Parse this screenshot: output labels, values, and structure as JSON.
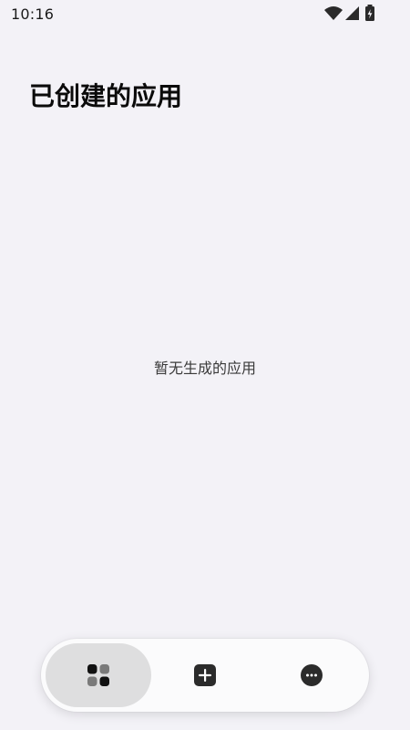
{
  "status_bar": {
    "time": "10:16",
    "icons": [
      "wifi-icon",
      "cellular-signal-icon",
      "battery-charging-icon"
    ]
  },
  "header": {
    "title": "已创建的应用"
  },
  "main": {
    "empty_state_text": "暂无生成的应用"
  },
  "bottom_nav": {
    "items": [
      {
        "icon": "grid-apps-icon",
        "selected": true
      },
      {
        "icon": "add-square-icon",
        "selected": false
      },
      {
        "icon": "more-dots-icon",
        "selected": false
      }
    ]
  },
  "colors": {
    "background": "#f3f2f7",
    "nav_background": "#fbfbfc",
    "nav_active": "#dededf",
    "icon_dark": "#2b2b2b",
    "text_primary": "#0b0b0b"
  }
}
